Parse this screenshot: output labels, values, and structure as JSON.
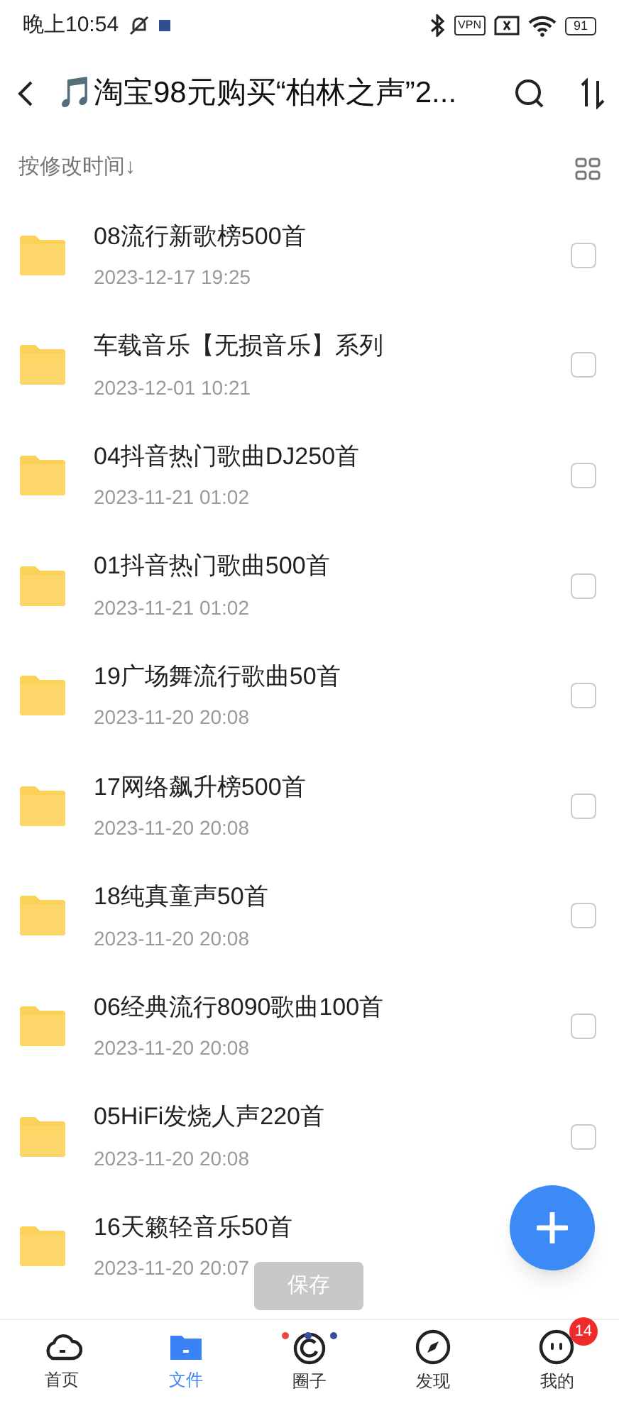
{
  "status_bar": {
    "time": "晚上10:54",
    "vpn": "VPN",
    "battery": "91"
  },
  "header": {
    "title": "🎵淘宝98元购买“柏林之声”2..."
  },
  "sort_bar": {
    "label": "按修改时间↓"
  },
  "files": [
    {
      "name": "08流行新歌榜500首",
      "date": "2023-12-17 19:25",
      "checked": false
    },
    {
      "name": "车载音乐【无损音乐】系列",
      "date": "2023-12-01 10:21",
      "checked": false
    },
    {
      "name": "04抖音热门歌曲DJ250首",
      "date": "2023-11-21 01:02",
      "checked": false
    },
    {
      "name": "01抖音热门歌曲500首",
      "date": "2023-11-21 01:02",
      "checked": false
    },
    {
      "name": "19广场舞流行歌曲50首",
      "date": "2023-11-20 20:08",
      "checked": false
    },
    {
      "name": "17网络飙升榜500首",
      "date": "2023-11-20 20:08",
      "checked": false
    },
    {
      "name": "18纯真童声50首",
      "date": "2023-11-20 20:08",
      "checked": false
    },
    {
      "name": "06经典流行8090歌曲100首",
      "date": "2023-11-20 20:08",
      "checked": false
    },
    {
      "name": "05HiFi发烧人声220首",
      "date": "2023-11-20 20:08",
      "checked": false
    },
    {
      "name": "16天籁轻音乐50首",
      "date": "2023-11-20 20:07"
    }
  ],
  "save_toast": "保存",
  "tabs": [
    {
      "kind": "home",
      "label": "首页",
      "selected": false
    },
    {
      "kind": "files",
      "label": "文件",
      "selected": true
    },
    {
      "kind": "circle",
      "label": "圈子",
      "selected": false
    },
    {
      "kind": "discover",
      "label": "发现",
      "selected": false
    },
    {
      "kind": "me",
      "label": "我的",
      "selected": false,
      "badge": "14"
    }
  ]
}
